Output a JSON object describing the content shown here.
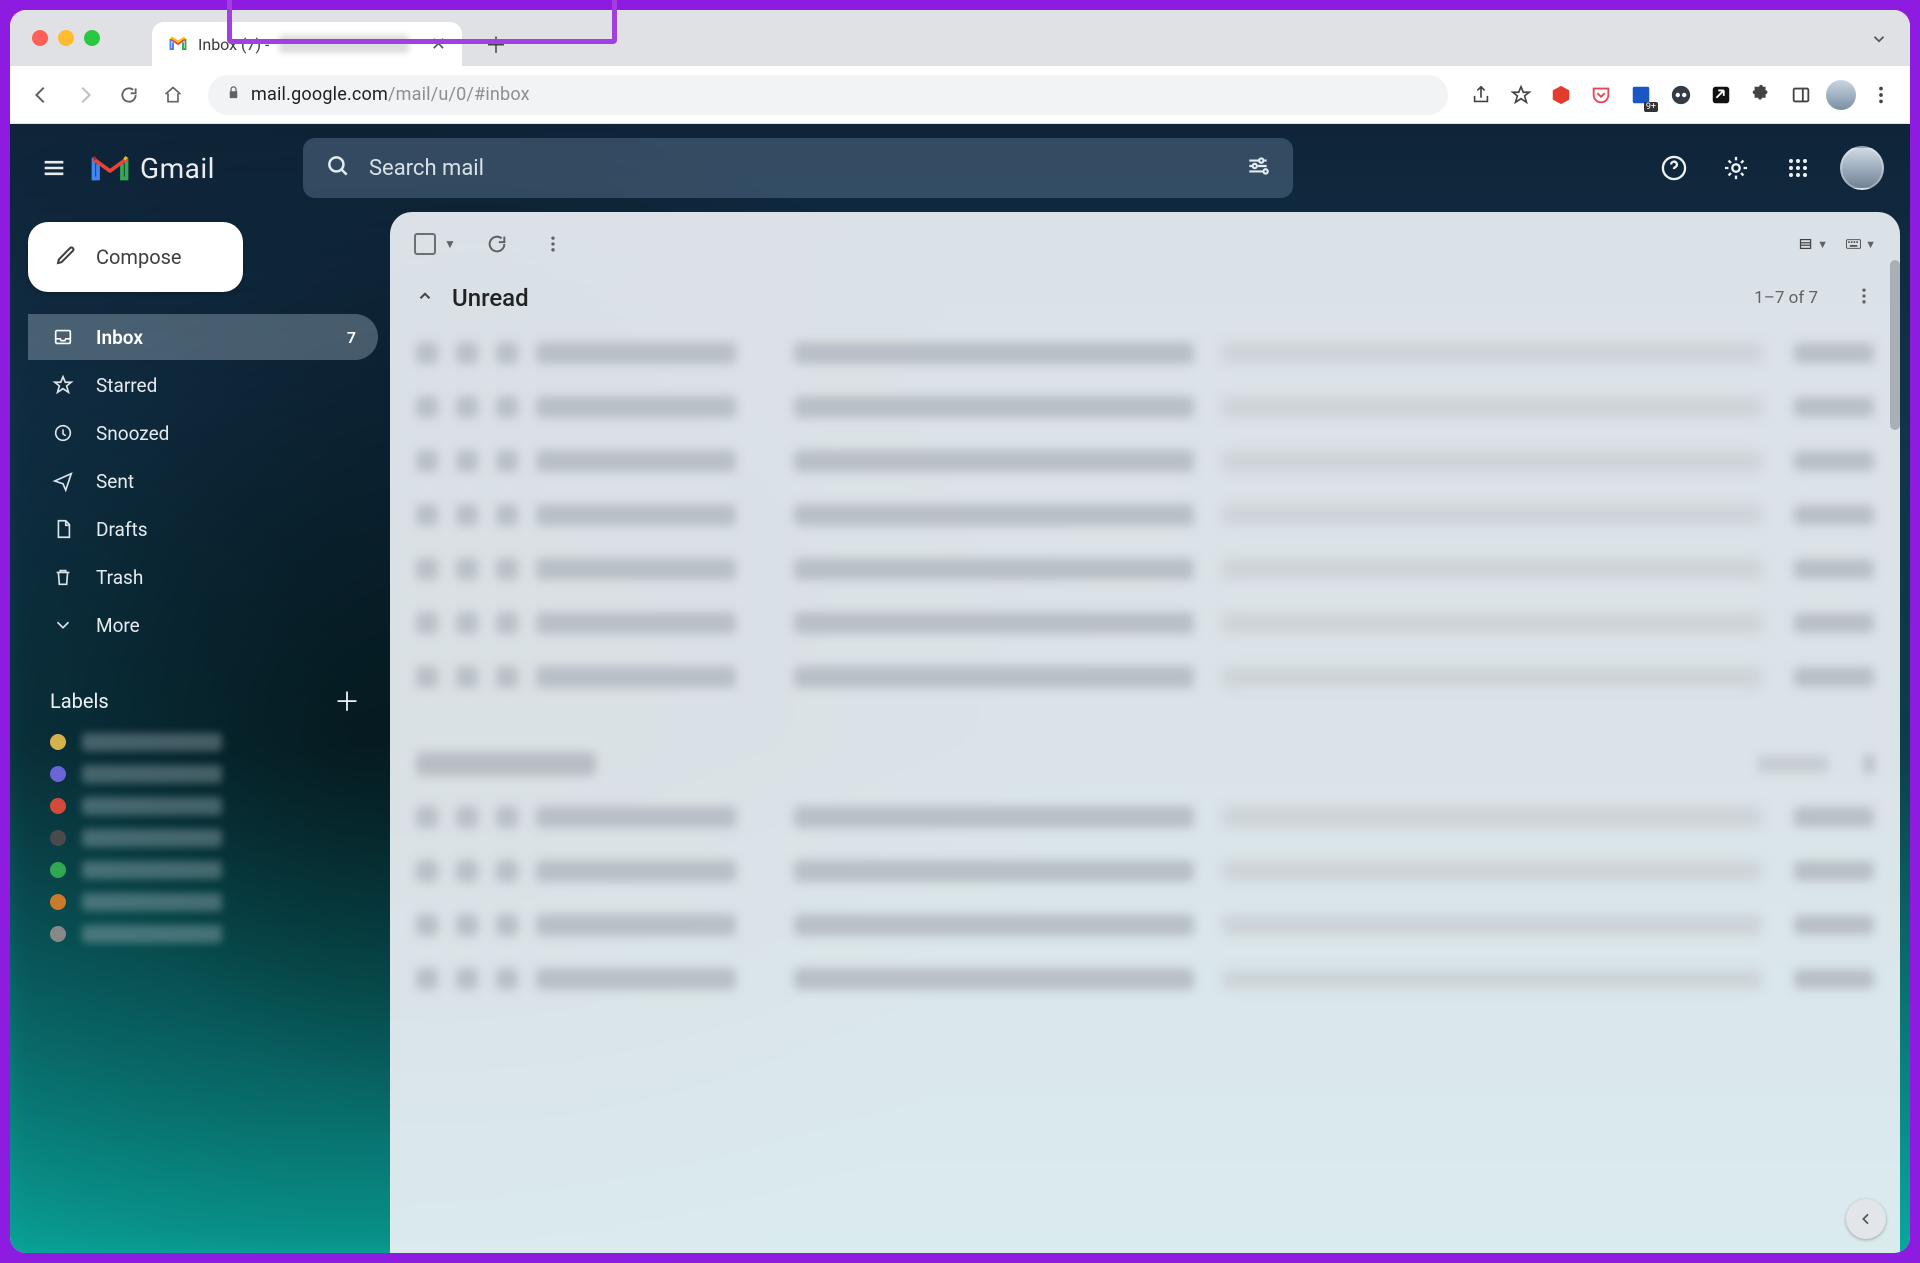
{
  "browser": {
    "tab_title": "Inbox (7) - ",
    "url_host": "mail.google.com",
    "url_path": "/mail/u/0/#inbox"
  },
  "gmail": {
    "product": "Gmail",
    "search_placeholder": "Search mail",
    "compose": "Compose",
    "sidebar": {
      "items": [
        {
          "label": "Inbox",
          "count": "7"
        },
        {
          "label": "Starred"
        },
        {
          "label": "Snoozed"
        },
        {
          "label": "Sent"
        },
        {
          "label": "Drafts"
        },
        {
          "label": "Trash"
        },
        {
          "label": "More"
        }
      ],
      "labels_header": "Labels",
      "label_colors": [
        "#d6b24a",
        "#6a64d8",
        "#d14a3a",
        "#4a4a4a",
        "#2fa84f",
        "#c97a2b",
        "#888"
      ]
    },
    "section": {
      "title": "Unread",
      "count": "1–7 of 7"
    }
  }
}
